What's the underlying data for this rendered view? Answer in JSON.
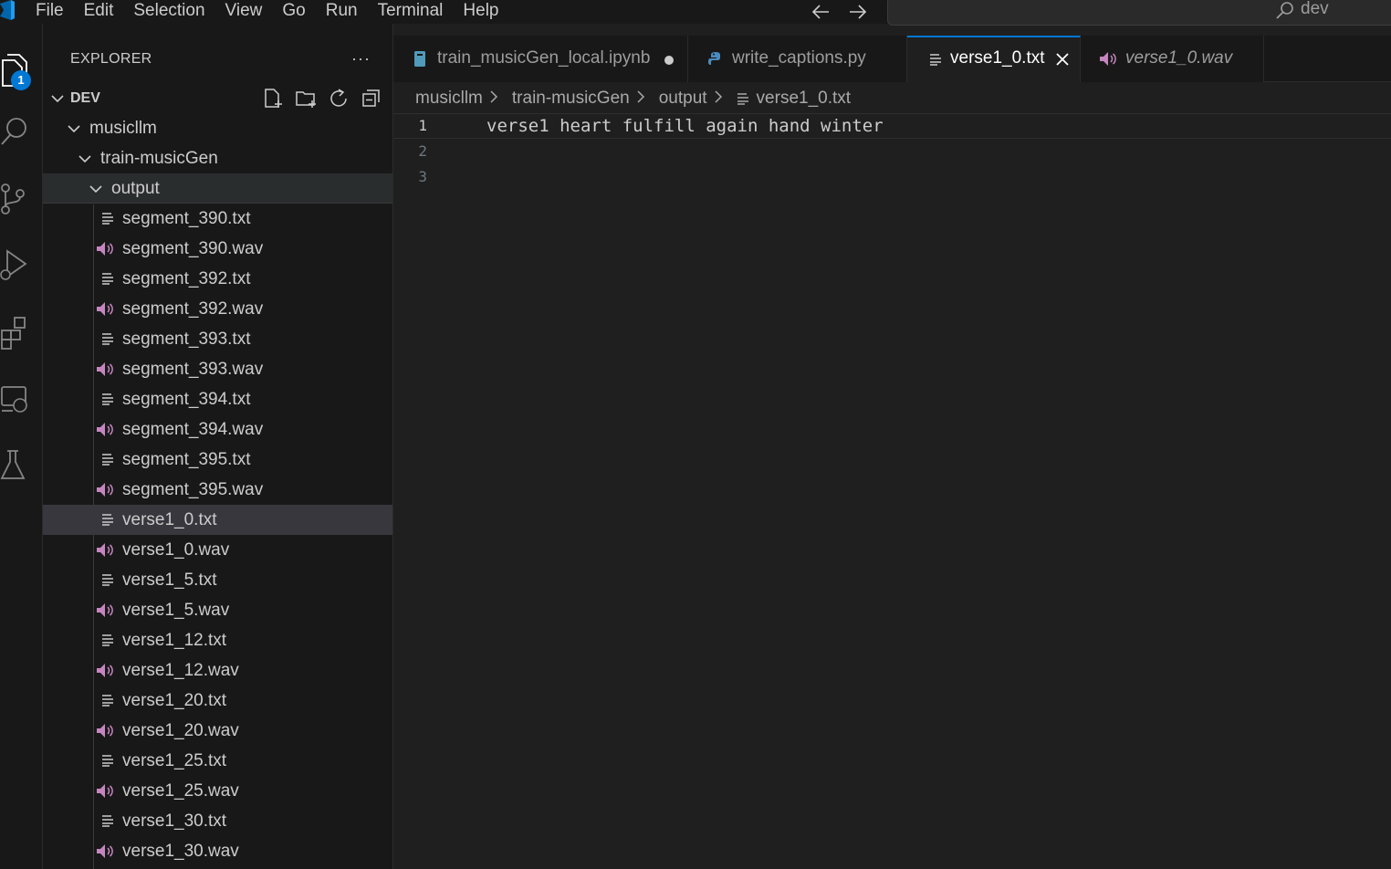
{
  "menu": [
    "File",
    "Edit",
    "Selection",
    "View",
    "Go",
    "Run",
    "Terminal",
    "Help"
  ],
  "command_center": {
    "text": "dev"
  },
  "activity_bar": {
    "explorer_badge": "1"
  },
  "explorer": {
    "title": "EXPLORER",
    "more_label": "···",
    "workspace": "DEV",
    "folders": [
      "musicllm",
      "train-musicGen",
      "output"
    ],
    "files": [
      {
        "name": "segment_390.txt",
        "type": "txt"
      },
      {
        "name": "segment_390.wav",
        "type": "wav"
      },
      {
        "name": "segment_392.txt",
        "type": "txt"
      },
      {
        "name": "segment_392.wav",
        "type": "wav"
      },
      {
        "name": "segment_393.txt",
        "type": "txt"
      },
      {
        "name": "segment_393.wav",
        "type": "wav"
      },
      {
        "name": "segment_394.txt",
        "type": "txt"
      },
      {
        "name": "segment_394.wav",
        "type": "wav"
      },
      {
        "name": "segment_395.txt",
        "type": "txt"
      },
      {
        "name": "segment_395.wav",
        "type": "wav"
      },
      {
        "name": "verse1_0.txt",
        "type": "txt"
      },
      {
        "name": "verse1_0.wav",
        "type": "wav"
      },
      {
        "name": "verse1_5.txt",
        "type": "txt"
      },
      {
        "name": "verse1_5.wav",
        "type": "wav"
      },
      {
        "name": "verse1_12.txt",
        "type": "txt"
      },
      {
        "name": "verse1_12.wav",
        "type": "wav"
      },
      {
        "name": "verse1_20.txt",
        "type": "txt"
      },
      {
        "name": "verse1_20.wav",
        "type": "wav"
      },
      {
        "name": "verse1_25.txt",
        "type": "txt"
      },
      {
        "name": "verse1_25.wav",
        "type": "wav"
      },
      {
        "name": "verse1_30.txt",
        "type": "txt"
      },
      {
        "name": "verse1_30.wav",
        "type": "wav"
      }
    ]
  },
  "tabs": [
    {
      "label": "train_musicGen_local.ipynb",
      "icon": "notebook-icon",
      "modified": true
    },
    {
      "label": "write_captions.py",
      "icon": "python-icon"
    },
    {
      "label": "verse1_0.txt",
      "icon": "text-file-icon",
      "active": true
    },
    {
      "label": "verse1_0.wav",
      "icon": "audio-file-icon",
      "preview": true
    }
  ],
  "breadcrumb": [
    "musicllm",
    "train-musicGen",
    "output",
    "verse1_0.txt"
  ],
  "editor": {
    "lines": [
      {
        "number": "1",
        "text": "verse1 heart fulfill again hand winter"
      },
      {
        "number": "2",
        "text": ""
      },
      {
        "number": "3",
        "text": ""
      }
    ]
  },
  "colors": {
    "accent": "#0078d4",
    "audio_icon": "#c586c0",
    "notebook_icon": "#519aba",
    "python_icon": "#4b8bbe"
  }
}
